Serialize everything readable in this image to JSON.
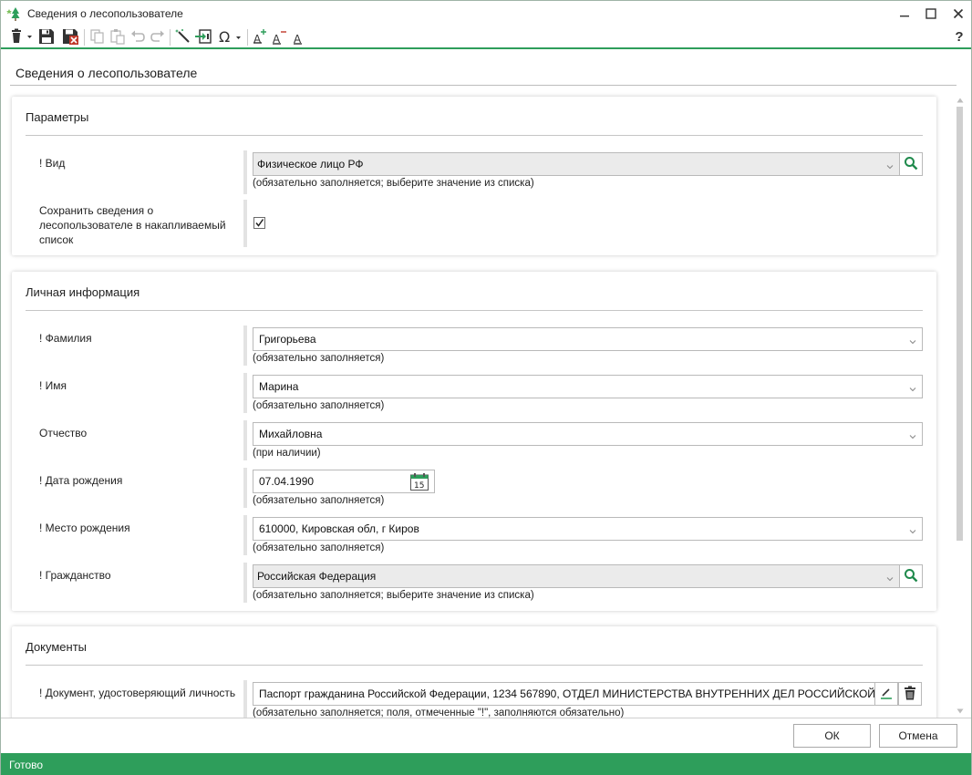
{
  "window": {
    "title": "Сведения о лесопользователе",
    "icon": "tree-icon",
    "controls": [
      "minimize-icon",
      "maximize-icon",
      "close-icon"
    ]
  },
  "toolbar": {
    "icons": [
      "delete-icon",
      "save-icon",
      "save-close-icon",
      "copy-icon",
      "paste-icon",
      "undo-icon",
      "redo-icon",
      "magic-wand-icon",
      "import-icon",
      "omega-icon",
      "font-increase-icon",
      "font-decrease-icon",
      "font-reset-icon",
      "help-icon"
    ],
    "help_label": "?"
  },
  "page": {
    "title": "Сведения о лесопользователе"
  },
  "sections": {
    "params": {
      "title": "Параметры",
      "vid": {
        "label": "! Вид",
        "value": "Физическое лицо РФ",
        "hint": "(обязательно заполняется; выберите значение из списка)"
      },
      "save_list": {
        "label": "Сохранить сведения о лесопользователе в накапливаемый список",
        "checked": true
      }
    },
    "personal": {
      "title": "Личная информация",
      "surname": {
        "label": "! Фамилия",
        "value": "Григорьева",
        "hint": "(обязательно заполняется)"
      },
      "name": {
        "label": "! Имя",
        "value": "Марина",
        "hint": "(обязательно заполняется)"
      },
      "patronymic": {
        "label": "Отчество",
        "value": "Михайловна",
        "hint": "(при наличии)"
      },
      "birthdate": {
        "label": "! Дата рождения",
        "value": "07.04.1990",
        "hint": "(обязательно заполняется)",
        "calendar_day": "15"
      },
      "birthplace": {
        "label": "! Место рождения",
        "value": "610000, Кировская обл, г Киров",
        "hint": "(обязательно заполняется)"
      },
      "citizenship": {
        "label": "! Гражданство",
        "value": "Российская Федерация",
        "hint": "(обязательно заполняется; выберите значение из списка)"
      }
    },
    "documents": {
      "title": "Документы",
      "id_doc": {
        "label": "! Документ, удостоверяющий личность",
        "value": "Паспорт гражданина Российской Федерации, 1234 567890, ОТДЕЛ МИНИСТЕРСТВА ВНУТРЕННИХ ДЕЛ РОССИЙСКОЙ ФЕДЕРАЦИИ",
        "hint": "(обязательно заполняется; поля, отмеченные \"!\", заполняются обязательно)"
      }
    }
  },
  "buttons": {
    "ok": "ОК",
    "cancel": "Отмена"
  },
  "status": {
    "text": "Готово"
  },
  "colors": {
    "accent": "#2e9e5b",
    "search_icon": "#1f8a4c"
  }
}
